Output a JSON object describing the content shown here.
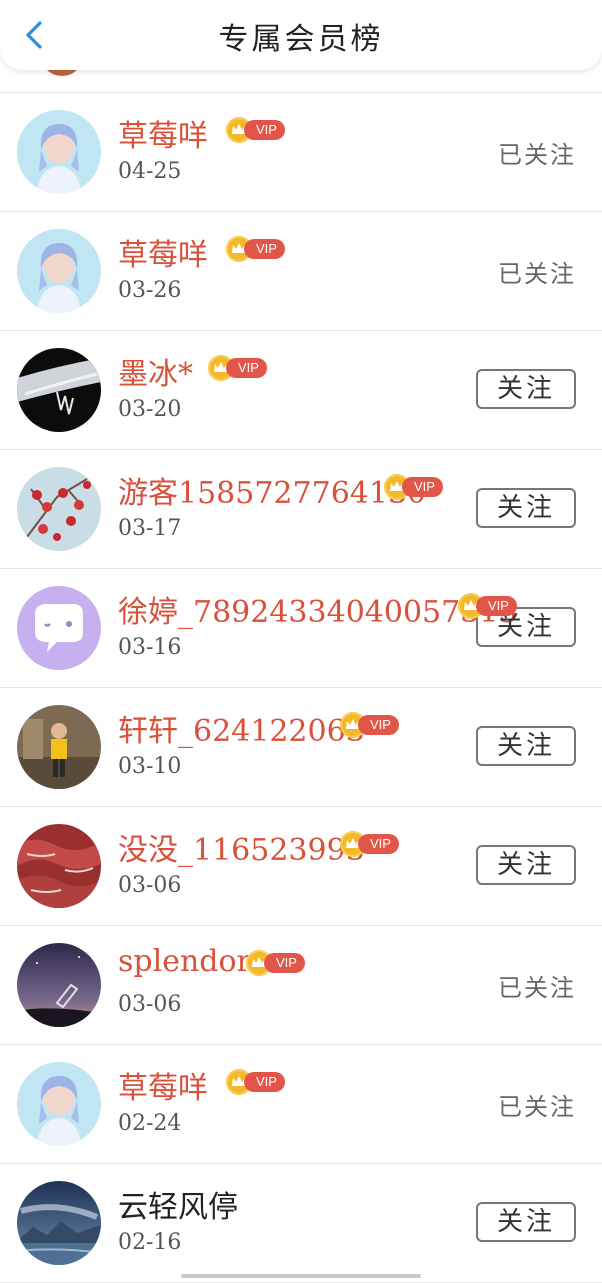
{
  "header": {
    "title": "专属会员榜"
  },
  "vip_label": "VIP",
  "members": [
    {
      "name": "草莓咩",
      "date": "04-25",
      "vip": true,
      "status": "已关注",
      "avatar": "avatar-blue-hair-girl"
    },
    {
      "name": "草莓咩",
      "date": "03-26",
      "vip": true,
      "status": "已关注",
      "avatar": "avatar-blue-hair-girl"
    },
    {
      "name": "墨冰*",
      "date": "03-20",
      "vip": true,
      "status": "关注",
      "avatar": "avatar-black-jewelry"
    },
    {
      "name": "游客1585727764130",
      "date": "03-17",
      "vip": true,
      "status": "关注",
      "avatar": "avatar-red-berries-snow"
    },
    {
      "name": "徐婷_78924334040057315",
      "date": "03-16",
      "vip": true,
      "status": "关注",
      "avatar": "avatar-purple-chat-bubble"
    },
    {
      "name": "轩轩_624122063",
      "date": "03-10",
      "vip": true,
      "status": "关注",
      "avatar": "avatar-child-yellow-shirt"
    },
    {
      "name": "没没_116523993",
      "date": "03-06",
      "vip": true,
      "status": "关注",
      "avatar": "avatar-red-meat"
    },
    {
      "name": "splendor",
      "date": "03-06",
      "vip": true,
      "status": "已关注",
      "avatar": "avatar-night-sky-telescope"
    },
    {
      "name": "草莓咩",
      "date": "02-24",
      "vip": true,
      "status": "已关注",
      "avatar": "avatar-blue-hair-girl"
    },
    {
      "name": "云轻风停",
      "date": "02-16",
      "vip": false,
      "status": "关注",
      "avatar": "avatar-mountain-sea-night"
    }
  ],
  "colors": {
    "vip_name": "#d9513b",
    "back_arrow": "#2a8fe0",
    "vip_tag": "#e2564a",
    "crown_coin": "#f4b92a"
  }
}
